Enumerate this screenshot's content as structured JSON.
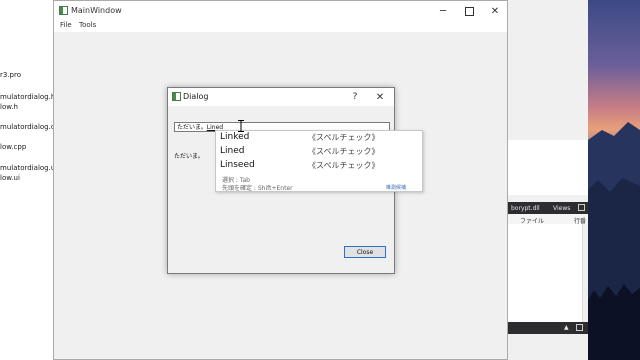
{
  "left_files": [
    "r3.pro",
    "mulatordialog.h",
    "low.h",
    "mulatordialog.cpp",
    "low.cpp",
    "mulatordialog.ui",
    "low.ui"
  ],
  "right_panel": {
    "dll_label": "borypt.dll",
    "views_label": "Views",
    "col_file": "ファイル",
    "col_line": "行番"
  },
  "main_window": {
    "title": "MainWindow",
    "menu": [
      "File",
      "Tools"
    ],
    "minimize_icon": "minimize-icon",
    "maximize_icon": "maximize-icon",
    "close_icon": "close-icon"
  },
  "dialog": {
    "title": "Dialog",
    "help_glyph": "?",
    "input_committed": "ただいま。",
    "input_composing": "Lined",
    "label_text": "ただいま。",
    "close_button": "Close"
  },
  "ime": {
    "candidates": [
      {
        "word": "Linked",
        "note": "《スペルチェック》"
      },
      {
        "word": "Lined",
        "note": "《スペルチェック》"
      },
      {
        "word": "Linseed",
        "note": "《スペルチェック》"
      }
    ],
    "hint_select": "選択 : Tab",
    "hint_confirm": "先頭を確定 : Shift+Enter",
    "more_label": "推測候補"
  }
}
